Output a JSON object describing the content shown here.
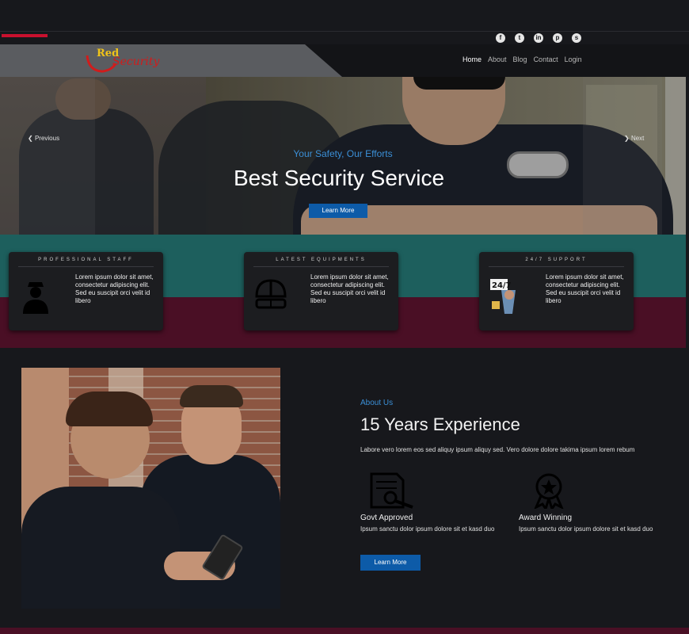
{
  "brand": {
    "word1": "Red",
    "word2": "Security"
  },
  "social": [
    "f",
    "t",
    "in",
    "p",
    "s"
  ],
  "social_icons": [
    "facebook-icon",
    "twitter-icon",
    "linkedin-icon",
    "pinterest-icon",
    "skype-icon"
  ],
  "nav": {
    "items": [
      "Home",
      "About",
      "Blog",
      "Contact",
      "Login"
    ],
    "active": "Home"
  },
  "hero": {
    "subtitle": "Your Safety, Our Efforts",
    "title": "Best Security Service",
    "button": "Learn More",
    "prev": "Previous",
    "next": "Next"
  },
  "features": [
    {
      "title": "PROFESSIONAL STAFF",
      "text": "Lorem ipsum dolor sit amet, consectetur adipiscing elit. Sed eu suscipit orci velit id libero",
      "icon": "officer-icon"
    },
    {
      "title": "LATEST EQUIPMENTS",
      "text": "Lorem ipsum dolor sit amet, consectetur adipiscing elit. Sed eu suscipit orci velit id libero",
      "icon": "helmet-icon"
    },
    {
      "title": "24/7 SUPPORT",
      "text": "Lorem ipsum dolor sit amet, consectetur adipiscing elit. Sed eu suscipit orci velit id libero",
      "icon": "support-icon"
    }
  ],
  "support_badge": "24/7",
  "about": {
    "subtitle": "About Us",
    "title": "15 Years Experience",
    "description": "Labore vero lorem eos sed aliquy ipsum aliquy sed. Vero dolore dolore takima ipsum lorem rebum",
    "items": [
      {
        "title": "Govt Approved",
        "text": "Ipsum sanctu dolor ipsum dolore sit et kasd duo",
        "icon": "certificate-icon"
      },
      {
        "title": "Award Winning",
        "text": "Ipsum sanctu dolor ipsum dolore sit et kasd duo",
        "icon": "award-icon"
      }
    ],
    "button": "Learn More"
  },
  "colors": {
    "accent_blue": "#3b8fd6",
    "button_blue": "#0d5ba8",
    "teal": "#1d5f5d",
    "maroon": "#4a0f25",
    "brand_red": "#c8102e"
  }
}
